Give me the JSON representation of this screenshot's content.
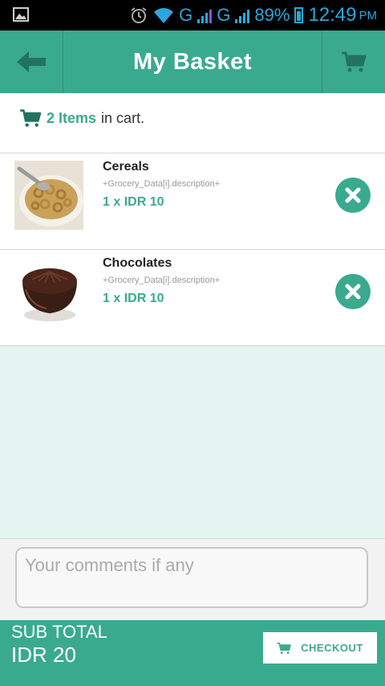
{
  "status_bar": {
    "network_1": "G",
    "network_2": "G",
    "battery": "89%",
    "time": "12:49",
    "ampm": "PM"
  },
  "header": {
    "title": "My Basket",
    "back_icon": "arrow-left-icon",
    "cart_icon": "cart-icon"
  },
  "summary": {
    "count_label": "2 Items",
    "suffix": "in cart."
  },
  "items": [
    {
      "name": "Cereals",
      "description": "+Grocery_Data[i].description+",
      "price": "1 x IDR 10"
    },
    {
      "name": "Chocolates",
      "description": "+Grocery_Data[i].description+",
      "price": "1 x IDR 10"
    }
  ],
  "comments": {
    "placeholder": "Your comments if any",
    "value": ""
  },
  "footer": {
    "subtotal_label": "SUB TOTAL",
    "subtotal_value": "IDR 20",
    "checkout_label": "CHECKOUT"
  },
  "colors": {
    "accent": "#3aaa8f",
    "status_bar_text": "#2aa7dc",
    "empty_area": "#e3f4f1"
  }
}
